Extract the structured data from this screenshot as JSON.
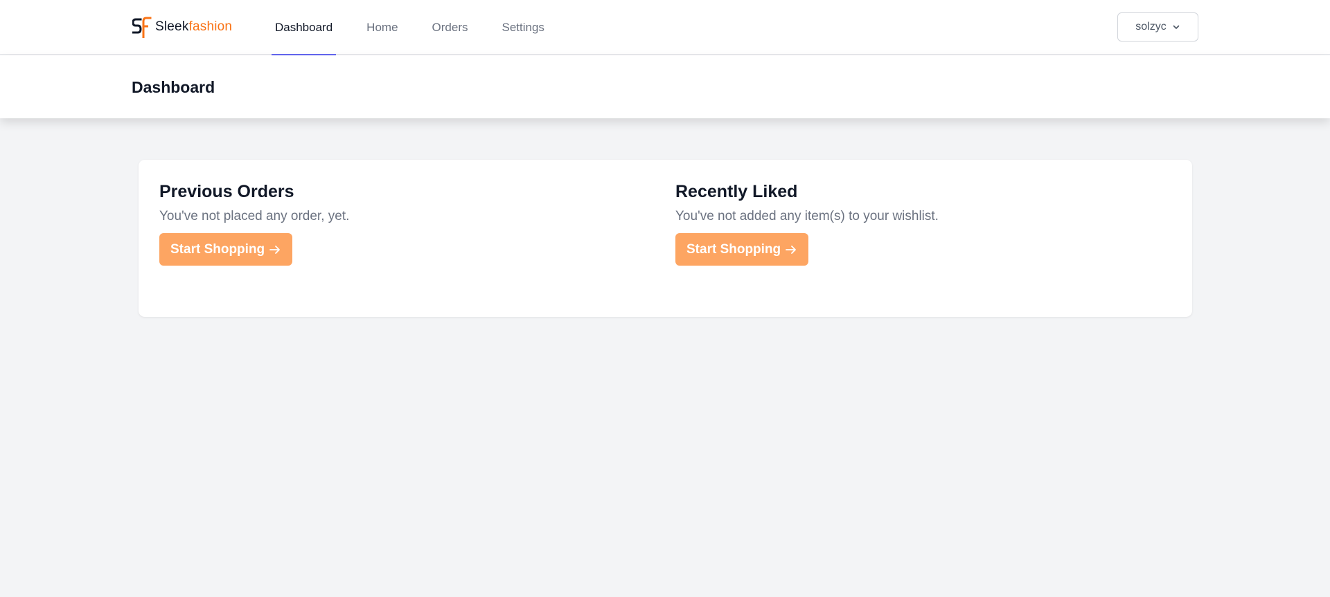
{
  "brand": {
    "part1": "Sleek",
    "part2": "fashion",
    "accent_color": "#f97316",
    "logo_icon": "sf-monogram-logo"
  },
  "nav": {
    "tabs": [
      {
        "label": "Dashboard",
        "active": true
      },
      {
        "label": "Home",
        "active": false
      },
      {
        "label": "Orders",
        "active": false
      },
      {
        "label": "Settings",
        "active": false
      }
    ],
    "active_indicator_color": "#6366f1"
  },
  "user_menu": {
    "username": "solzyc",
    "icon": "chevron-down-icon"
  },
  "page": {
    "title": "Dashboard"
  },
  "sections": {
    "previous_orders": {
      "title": "Previous Orders",
      "message": "You've not placed any order, yet.",
      "button_label": "Start Shopping",
      "button_icon": "arrow-right-icon"
    },
    "recently_liked": {
      "title": "Recently Liked",
      "message": "You've not added any item(s) to your wishlist.",
      "button_label": "Start Shopping",
      "button_icon": "arrow-right-icon"
    }
  },
  "colors": {
    "button_bg": "#fda562",
    "page_bg": "#f3f4f6"
  }
}
